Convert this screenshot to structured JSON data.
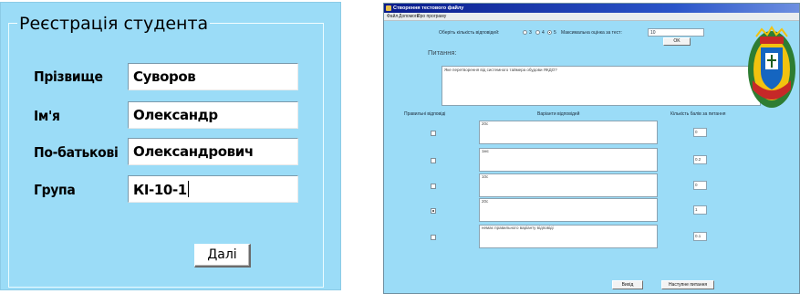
{
  "registration": {
    "title": "Реєстрація студента",
    "fields": [
      {
        "label": "Прізвище",
        "value": "Суворов"
      },
      {
        "label": "Ім'я",
        "value": "Олександр"
      },
      {
        "label": "По-батькові",
        "value": "Олександрович"
      },
      {
        "label": "Група",
        "value": "КІ-10-1"
      }
    ],
    "next_label": "Далі"
  },
  "test_editor": {
    "title": "Створення тестового файлу",
    "menu": [
      "Файл",
      "Допомога",
      "Про програму"
    ],
    "answer_count_label": "Оберіть кількість відповідей:",
    "answer_count_options": [
      "3",
      "4",
      "5"
    ],
    "answer_count_selected": "5",
    "max_score_label": "Максимальна оцінка за тест:",
    "max_score_value": "10",
    "ok_label": "OK",
    "question_label": "Питання:",
    "question_text": "Яке перетворення від системного таймера обудови ЯКДО?",
    "col_correct": "Правильні відповіді",
    "col_variants": "Варіанти відповідей",
    "col_points": "Кількість балів за питання",
    "answers": [
      {
        "text": "20с",
        "correct": false,
        "points": "0"
      },
      {
        "text": "1мс",
        "correct": false,
        "points": "0.2"
      },
      {
        "text": "10с",
        "correct": false,
        "points": "0"
      },
      {
        "text": "20с",
        "correct": true,
        "points": "1"
      },
      {
        "text": "немає правильного варіанту відповіді",
        "correct": false,
        "points": "0.1"
      }
    ],
    "exit_label": "Вихід",
    "next_question_label": "Наступне питання",
    "colors": {
      "window_bg": "#9bdcf7",
      "titlebar": "#0a1c8c"
    },
    "emblem_icon": "university-coat-of-arms-icon"
  }
}
